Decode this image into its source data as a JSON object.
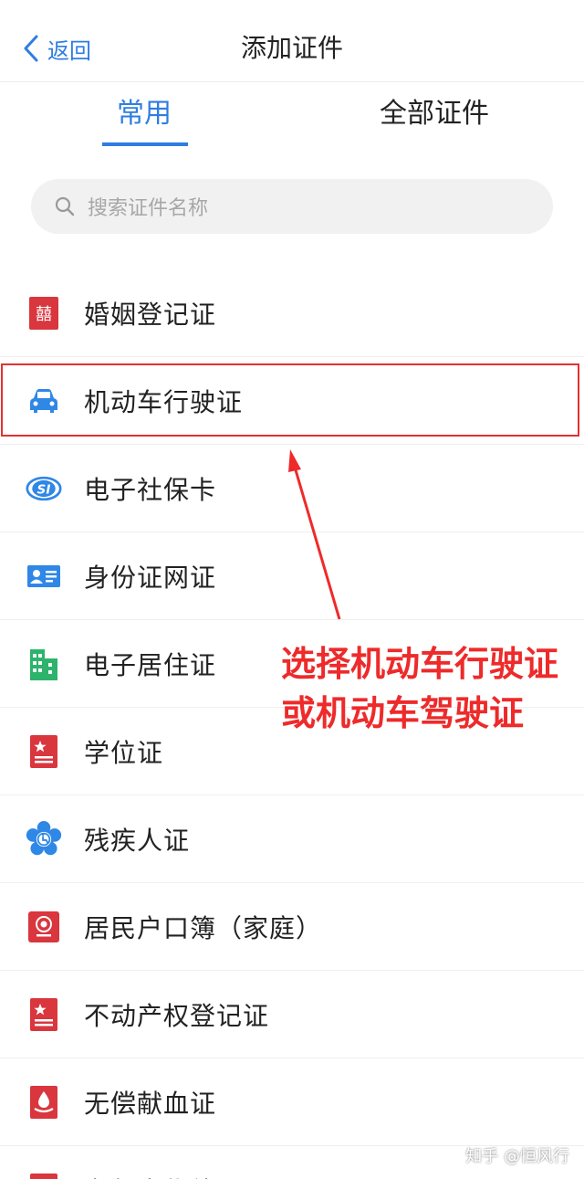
{
  "header": {
    "back_label": "返回",
    "title": "添加证件"
  },
  "tabs": [
    {
      "label": "常用",
      "active": true
    },
    {
      "label": "全部证件",
      "active": false
    }
  ],
  "search": {
    "placeholder": "搜索证件名称"
  },
  "items": [
    {
      "label": "婚姻登记证",
      "icon": "double-happiness-icon",
      "color": "#d9363e"
    },
    {
      "label": "机动车行驶证",
      "icon": "car-icon",
      "color": "#2f87e6"
    },
    {
      "label": "电子社保卡",
      "icon": "social-security-icon",
      "color": "#2f87e6"
    },
    {
      "label": "身份证网证",
      "icon": "id-card-icon",
      "color": "#2f87e6"
    },
    {
      "label": "电子居住证",
      "icon": "building-icon",
      "color": "#2db36b"
    },
    {
      "label": "学位证",
      "icon": "certificate-star-icon",
      "color": "#d9363e"
    },
    {
      "label": "残疾人证",
      "icon": "disability-icon",
      "color": "#2f87e6"
    },
    {
      "label": "居民户口簿（家庭）",
      "icon": "household-register-icon",
      "color": "#d9363e"
    },
    {
      "label": "不动产权登记证",
      "icon": "certificate-star-icon",
      "color": "#d9363e"
    },
    {
      "label": "无偿献血证",
      "icon": "blood-donation-icon",
      "color": "#d9363e"
    },
    {
      "label": "老年人优待证",
      "icon": "certificate-icon",
      "color": "#d9363e"
    }
  ],
  "annotation": {
    "line1": "选择机动车行驶证",
    "line2": "或机动车驾驶证",
    "color": "#ee2a2a"
  },
  "watermark": "知乎 @恒风行",
  "colors": {
    "accent": "#2f7de1"
  }
}
